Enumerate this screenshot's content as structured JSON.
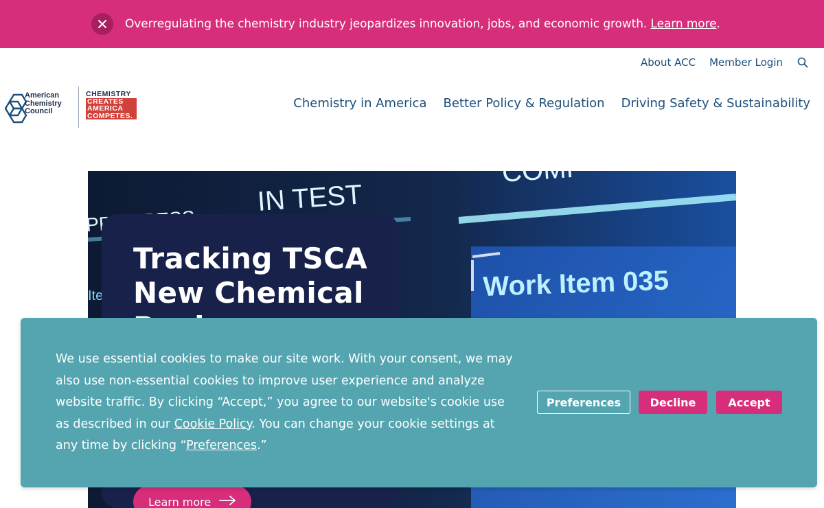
{
  "alert": {
    "text": "Overregulating the chemistry industry jeopardizes innovation, jobs, and economic growth. ",
    "link": "Learn more",
    "trail": ".",
    "close_icon": "close-icon"
  },
  "utility_nav": {
    "about": "About ACC",
    "login": "Member Login",
    "search_icon": "search-icon"
  },
  "logo": {
    "acc_line1": "American",
    "acc_line2": "Chemistry",
    "acc_line3": "Council",
    "cca_line1": "CHEMISTRY",
    "cca_line2": "CREATES",
    "cca_line3": "AMERICA",
    "cca_line4": "COMPETES."
  },
  "main_nav": {
    "items": [
      {
        "label": "Chemistry in America"
      },
      {
        "label": "Better Policy & Regulation"
      },
      {
        "label": "Driving Safety & Sustainability"
      }
    ]
  },
  "hero": {
    "title": "Tracking TSCA New Chemical Reviews",
    "button": "Learn more",
    "image_texts": {
      "progress": "PROGRESS",
      "in_test": "IN TEST",
      "work_item": "Work Item 035",
      "comp": "COMP",
      "item": "Iten"
    }
  },
  "cookie": {
    "text_1": "We use essential cookies to make our site work. With your consent, we may also use non-essential cookies to improve user experience and analyze website traffic. By clicking “Accept,” you agree to our website's cookie use as described in our ",
    "policy_link": "Cookie Policy",
    "text_2": ". You can change your cookie settings at any time by clicking “",
    "pref_link": "Preferences",
    "text_3": ".”",
    "btn_preferences": "Preferences",
    "btn_decline": "Decline",
    "btn_accept": "Accept"
  },
  "colors": {
    "brand_pink": "#d62e7a",
    "nav_blue": "#1d4f7c",
    "cookie_teal": "#55a5b0",
    "hero_card": "#17214a"
  }
}
